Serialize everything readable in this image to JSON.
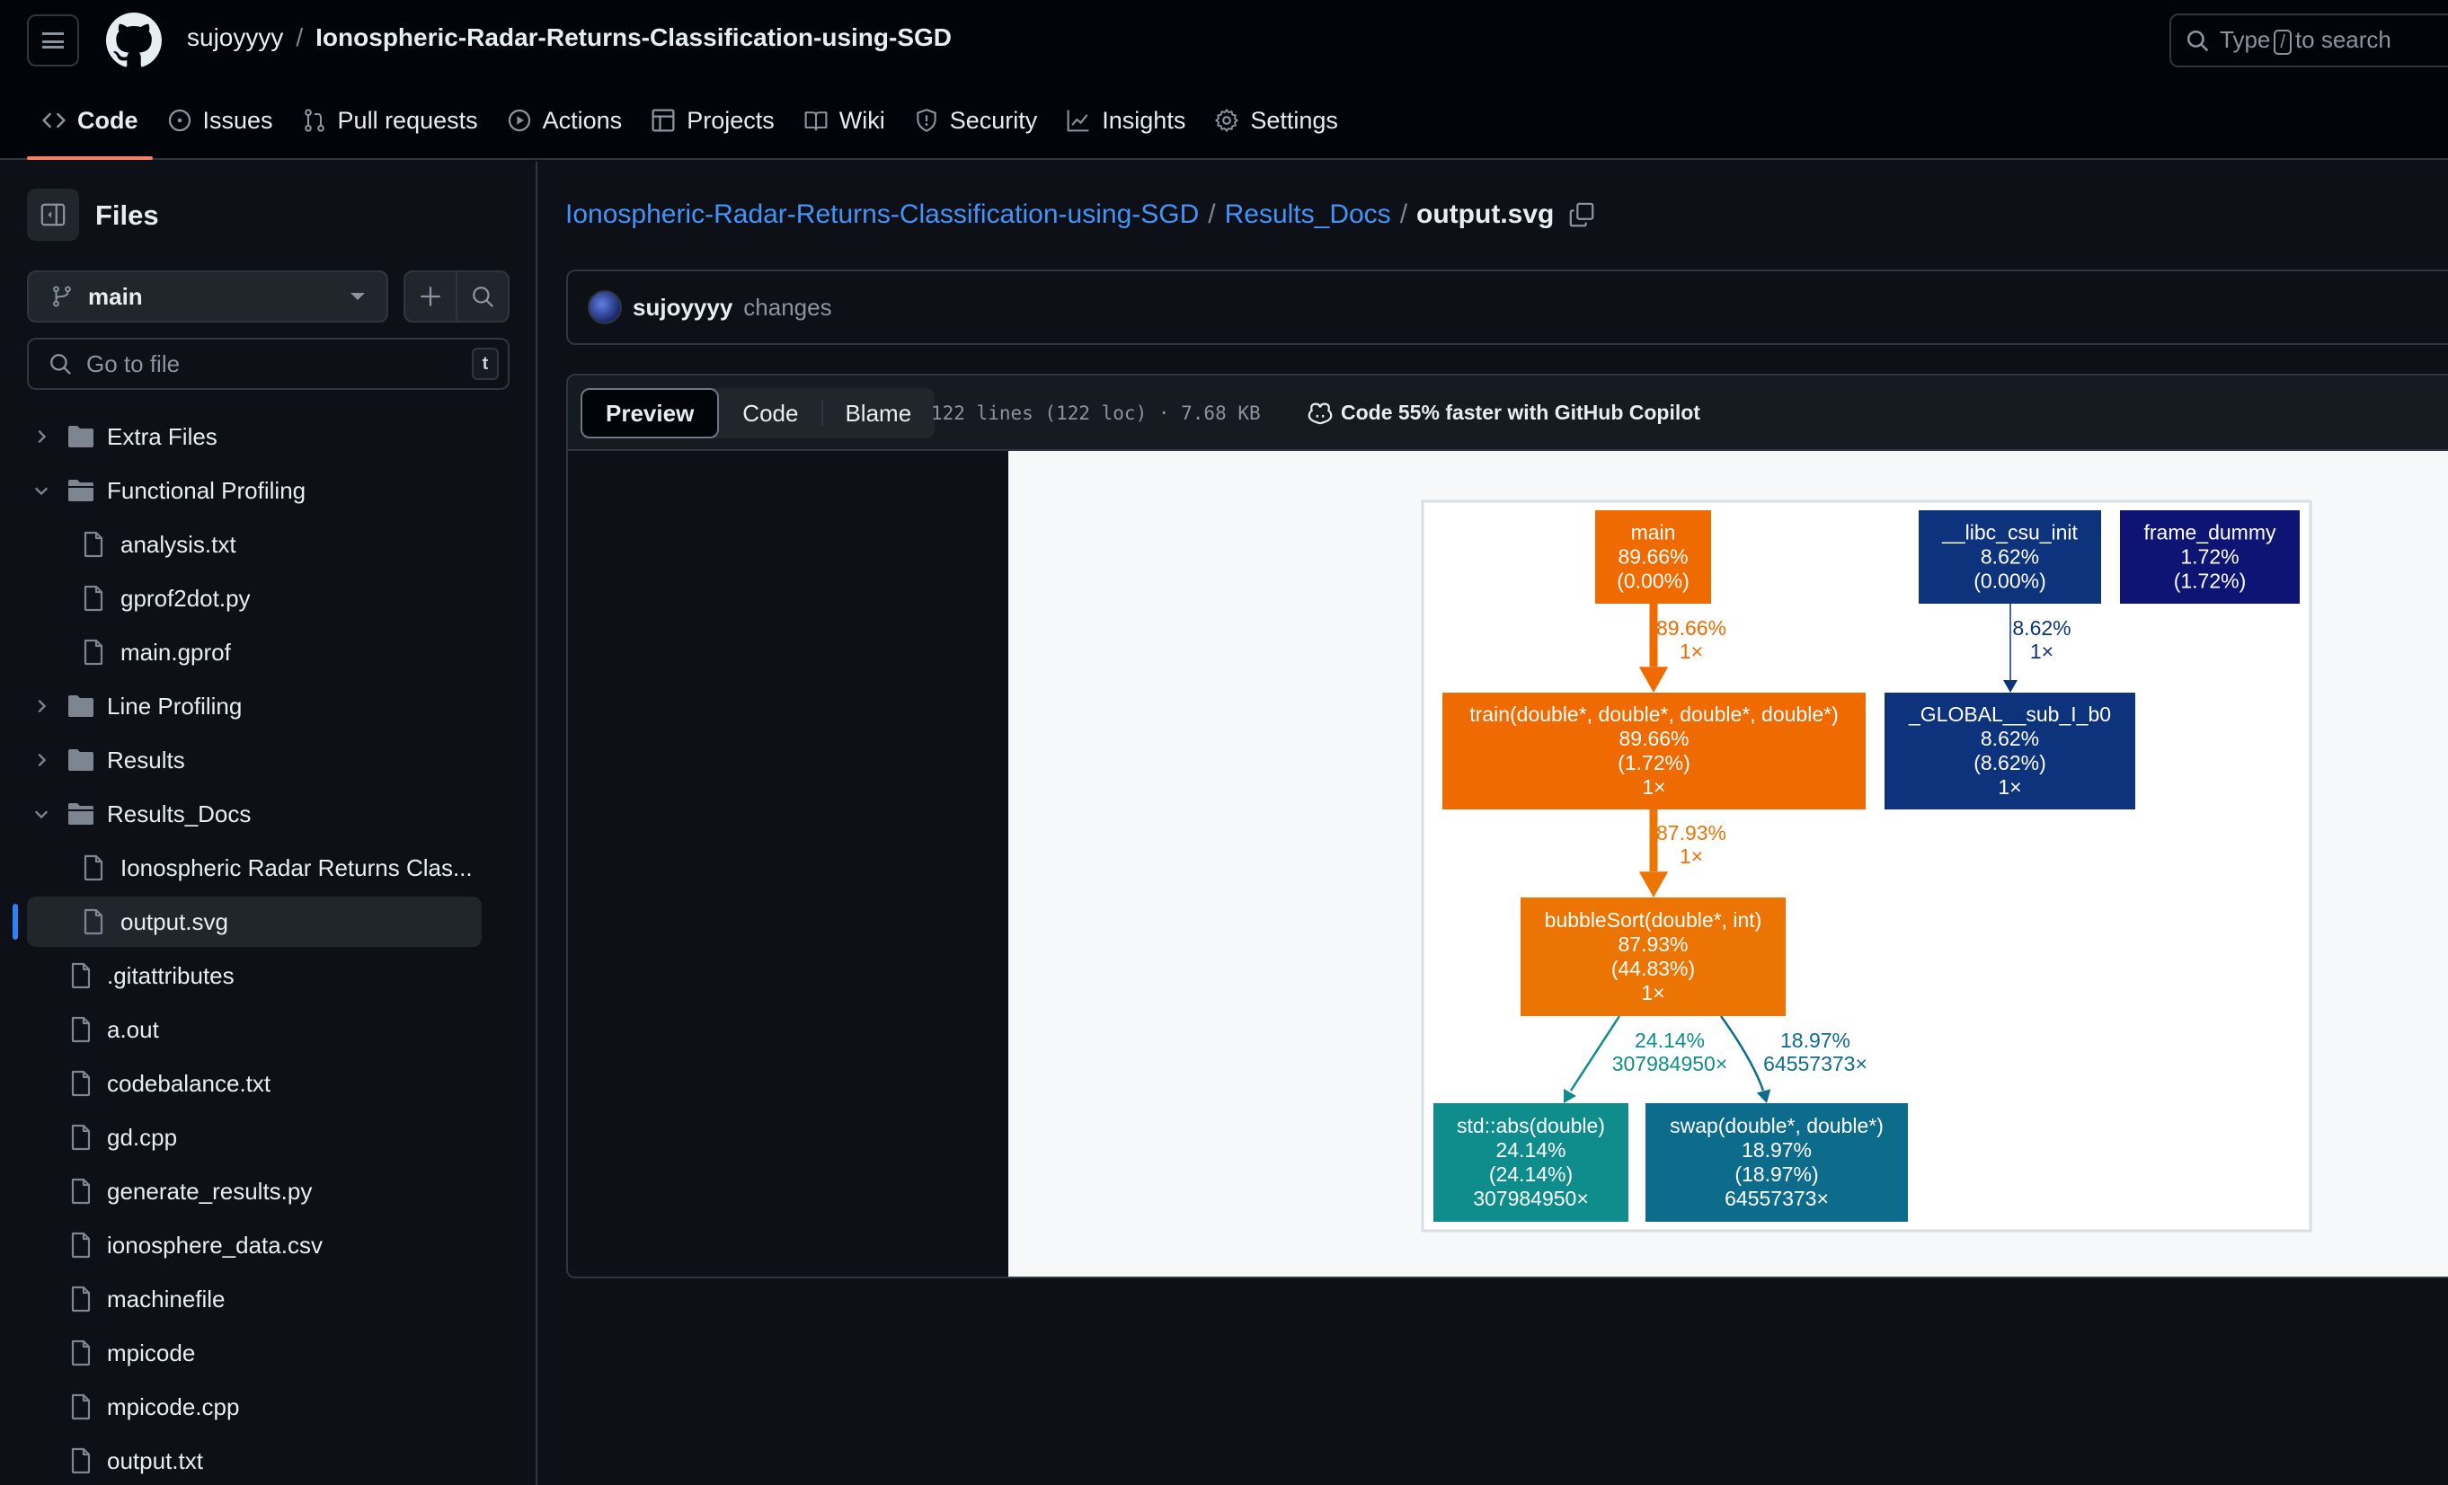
{
  "header": {
    "owner": "sujoyyyy",
    "separator": "/",
    "repo": "Ionospheric-Radar-Returns-Classification-using-SGD",
    "search_prefix": "Type",
    "search_key": "/",
    "search_suffix": "to search"
  },
  "nav": {
    "tabs": [
      {
        "label": "Code",
        "icon": "code-icon",
        "active": true
      },
      {
        "label": "Issues",
        "icon": "issue-icon"
      },
      {
        "label": "Pull requests",
        "icon": "pull-request-icon"
      },
      {
        "label": "Actions",
        "icon": "play-icon"
      },
      {
        "label": "Projects",
        "icon": "table-icon"
      },
      {
        "label": "Wiki",
        "icon": "book-icon"
      },
      {
        "label": "Security",
        "icon": "shield-icon"
      },
      {
        "label": "Insights",
        "icon": "graph-icon"
      },
      {
        "label": "Settings",
        "icon": "gear-icon"
      }
    ]
  },
  "sidebar": {
    "title": "Files",
    "branch": "main",
    "goto_placeholder": "Go to file",
    "goto_hotkey": "t",
    "tree": [
      {
        "label": "Extra Files",
        "type": "folder",
        "expanded": false,
        "depth": 0
      },
      {
        "label": "Functional Profiling",
        "type": "folder",
        "expanded": true,
        "depth": 0
      },
      {
        "label": "analysis.txt",
        "type": "file",
        "depth": 1
      },
      {
        "label": "gprof2dot.py",
        "type": "file",
        "depth": 1
      },
      {
        "label": "main.gprof",
        "type": "file",
        "depth": 1
      },
      {
        "label": "Line Profiling",
        "type": "folder",
        "expanded": false,
        "depth": 0
      },
      {
        "label": "Results",
        "type": "folder",
        "expanded": false,
        "depth": 0
      },
      {
        "label": "Results_Docs",
        "type": "folder",
        "expanded": true,
        "depth": 0
      },
      {
        "label": "Ionospheric Radar Returns Clas...",
        "type": "file",
        "depth": 1
      },
      {
        "label": "output.svg",
        "type": "file",
        "depth": 1,
        "selected": true
      },
      {
        "label": ".gitattributes",
        "type": "file",
        "depth": 0
      },
      {
        "label": "a.out",
        "type": "file",
        "depth": 0
      },
      {
        "label": "codebalance.txt",
        "type": "file",
        "depth": 0
      },
      {
        "label": "gd.cpp",
        "type": "file",
        "depth": 0
      },
      {
        "label": "generate_results.py",
        "type": "file",
        "depth": 0
      },
      {
        "label": "ionosphere_data.csv",
        "type": "file",
        "depth": 0
      },
      {
        "label": "machinefile",
        "type": "file",
        "depth": 0
      },
      {
        "label": "mpicode",
        "type": "file",
        "depth": 0
      },
      {
        "label": "mpicode.cpp",
        "type": "file",
        "depth": 0
      },
      {
        "label": "output.txt",
        "type": "file",
        "depth": 0
      }
    ]
  },
  "breadcrumb": {
    "repo": "Ionospheric-Radar-Returns-Classification-using-SGD",
    "folder": "Results_Docs",
    "file": "output.svg",
    "sep": "/"
  },
  "commit": {
    "author": "sujoyyyy",
    "message": "changes"
  },
  "file_header": {
    "tabs": [
      "Preview",
      "Code",
      "Blame"
    ],
    "active_tab": "Preview",
    "meta": "122 lines (122 loc) · 7.68 KB",
    "copilot": "Code 55% faster with GitHub Copilot"
  },
  "call_graph": {
    "nodes": [
      {
        "id": "main",
        "lines": [
          "main",
          "89.66%",
          "(0.00%)"
        ],
        "color": "#ef6a00"
      },
      {
        "id": "libc_csu_init",
        "lines": [
          "__libc_csu_init",
          "8.62%",
          "(0.00%)"
        ],
        "color": "#0d337d"
      },
      {
        "id": "frame_dummy",
        "lines": [
          "frame_dummy",
          "1.72%",
          "(1.72%)"
        ],
        "color": "#0d1474"
      },
      {
        "id": "train",
        "lines": [
          "train(double*, double*, double*, double*)",
          "89.66%",
          "(1.72%)",
          "1×"
        ],
        "color": "#ef6a00"
      },
      {
        "id": "global_sub",
        "lines": [
          "_GLOBAL__sub_I_b0",
          "8.62%",
          "(8.62%)",
          "1×"
        ],
        "color": "#0d337d"
      },
      {
        "id": "bubbleSort",
        "lines": [
          "bubbleSort(double*, int)",
          "87.93%",
          "(44.83%)",
          "1×"
        ],
        "color": "#ec7402"
      },
      {
        "id": "std_abs",
        "lines": [
          "std::abs(double)",
          "24.14%",
          "(24.14%)",
          "307984950×"
        ],
        "color": "#0f8c8c"
      },
      {
        "id": "swap",
        "lines": [
          "swap(double*, double*)",
          "18.97%",
          "(18.97%)",
          "64557373×"
        ],
        "color": "#0d6b8c"
      }
    ],
    "edges": [
      {
        "from": "main",
        "to": "train",
        "lines": [
          "89.66%",
          "1×"
        ],
        "color": "#ef6a00"
      },
      {
        "from": "libc_csu_init",
        "to": "global_sub",
        "lines": [
          "8.62%",
          "1×"
        ],
        "color": "#0d337d"
      },
      {
        "from": "train",
        "to": "bubbleSort",
        "lines": [
          "87.93%",
          "1×"
        ],
        "color": "#ec7402"
      },
      {
        "from": "bubbleSort",
        "to": "std_abs",
        "lines": [
          "24.14%",
          "307984950×"
        ],
        "color": "#0f8c8c"
      },
      {
        "from": "bubbleSort",
        "to": "swap",
        "lines": [
          "18.97%",
          "64557373×"
        ],
        "color": "#0d6b8c"
      }
    ]
  }
}
